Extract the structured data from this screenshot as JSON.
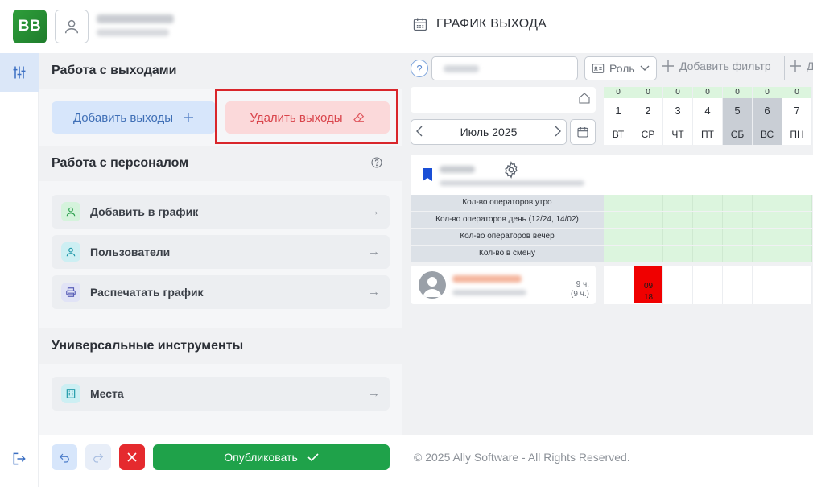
{
  "app": {
    "logo_text": "BB",
    "page_title": "ГРАФИК ВЫХОДА"
  },
  "panel": {
    "shifts_section": {
      "title": "Работа с выходами",
      "add_label": "Добавить выходы",
      "delete_label": "Удалить выходы"
    },
    "staff_section": {
      "title": "Работа с персоналом",
      "items": [
        {
          "label": "Добавить в график",
          "icon": "user-add-icon"
        },
        {
          "label": "Пользователи",
          "icon": "user-icon"
        },
        {
          "label": "Распечатать график",
          "icon": "printer-icon"
        }
      ]
    },
    "tools_section": {
      "title": "Универсальные инструменты",
      "items": [
        {
          "label": "Места",
          "icon": "building-icon"
        }
      ]
    }
  },
  "bottom": {
    "publish_label": "Опубликовать",
    "copyright": "© 2025 Ally Software - All Rights Reserved."
  },
  "schedule": {
    "filter": {
      "help": "?",
      "role_label": "Роль",
      "add_filter_label": "Добавить фильтр",
      "add_filter_label_2": "Д"
    },
    "month_label": "Июль 2025",
    "days": [
      {
        "count": "0",
        "num": "1",
        "dow": "ВТ",
        "weekend": false
      },
      {
        "count": "0",
        "num": "2",
        "dow": "СР",
        "weekend": false
      },
      {
        "count": "0",
        "num": "3",
        "dow": "ЧТ",
        "weekend": false
      },
      {
        "count": "0",
        "num": "4",
        "dow": "ПТ",
        "weekend": false
      },
      {
        "count": "0",
        "num": "5",
        "dow": "СБ",
        "weekend": true
      },
      {
        "count": "0",
        "num": "6",
        "dow": "ВС",
        "weekend": true
      },
      {
        "count": "0",
        "num": "7",
        "dow": "ПН",
        "weekend": false
      }
    ],
    "stats_rows": [
      "Кол-во операторов утро",
      "Кол-во операторов день (12/24, 14/02)",
      "Кол-во операторов вечер",
      "Кол-во в смену"
    ],
    "employee": {
      "hours_line1": "9 ч.",
      "hours_line2": "(9 ч.)",
      "shift_start": "09",
      "shift_end": "18"
    }
  },
  "colors": {
    "accent_blue": "#3f6fb6",
    "delete_red": "#d9434a",
    "highlight_frame": "#d9262b",
    "publish_green": "#1fa24a",
    "shift_red": "#f00000",
    "count_green": "#dcf5de"
  }
}
